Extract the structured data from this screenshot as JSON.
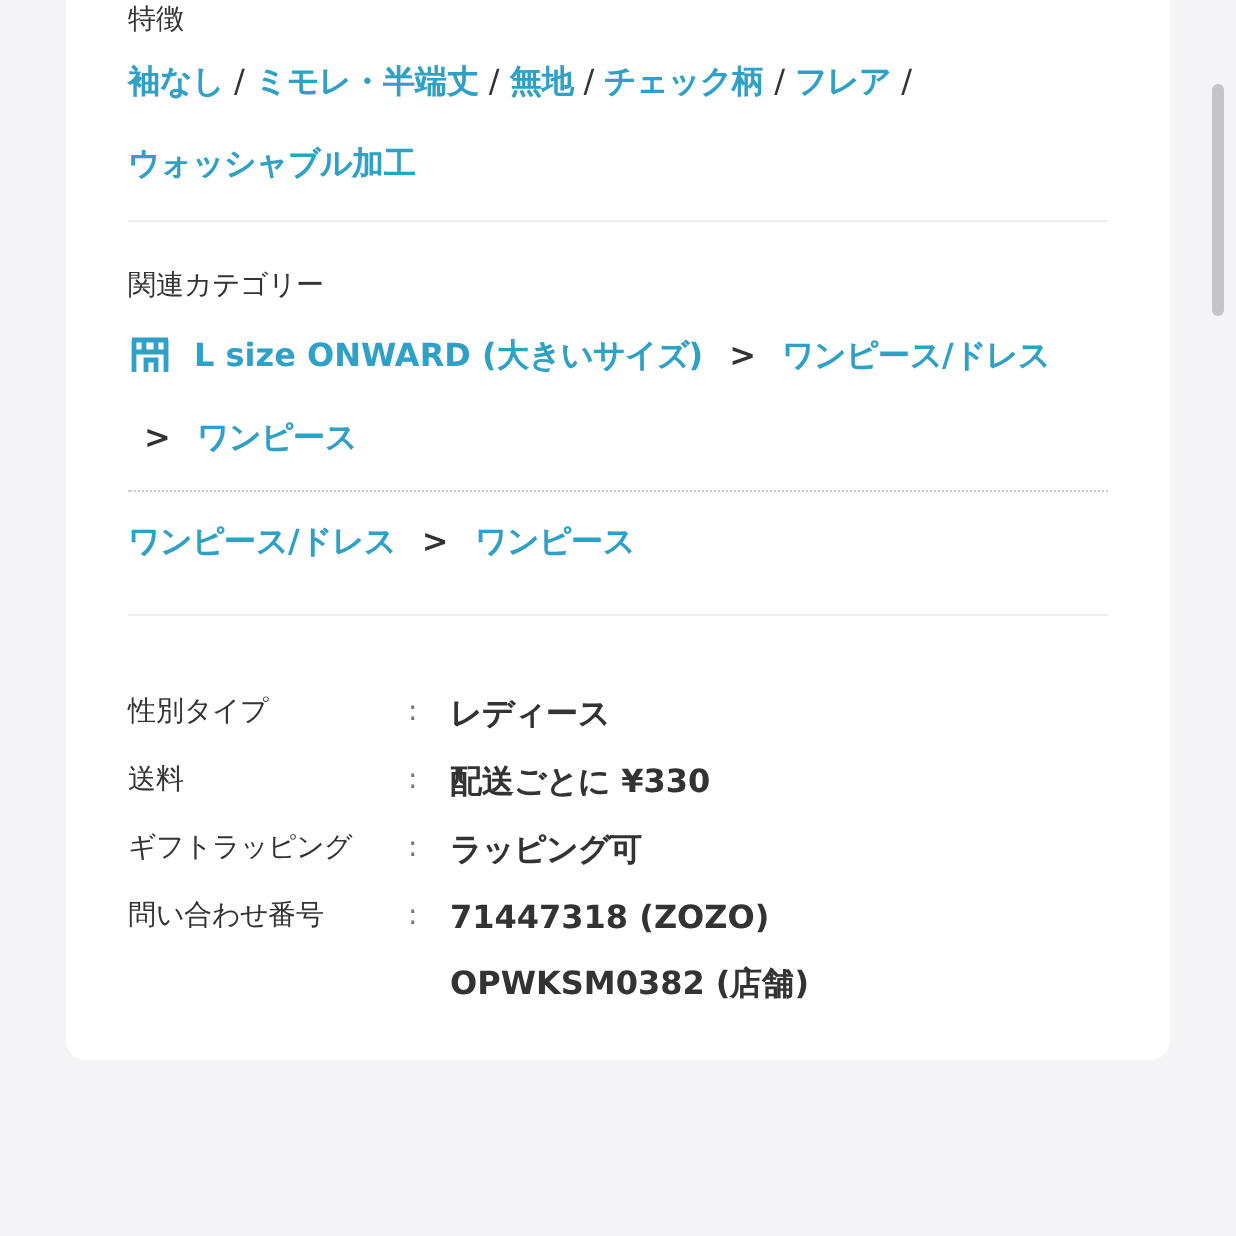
{
  "features": {
    "title": "特徴",
    "items": [
      {
        "label": "袖なし"
      },
      {
        "sep": "/",
        "label": "ミモレ・半端丈"
      },
      {
        "sep": "/",
        "label": "無地"
      },
      {
        "sep": "/",
        "label": "チェック柄"
      },
      {
        "sep": "/",
        "label": "フレア"
      },
      {
        "sep": "/",
        "label": "ウォッシャブル加工"
      }
    ]
  },
  "categories": {
    "title": "関連カテゴリー",
    "paths": [
      {
        "shop": true,
        "items": [
          {
            "label": "L size ONWARD (大きいサイズ)"
          },
          {
            "sep": ">",
            "label": "ワンピース/ドレス"
          },
          {
            "sep": ">",
            "label": "ワンピース"
          }
        ]
      },
      {
        "shop": false,
        "items": [
          {
            "label": "ワンピース/ドレス"
          },
          {
            "sep": ">",
            "label": "ワンピース"
          }
        ]
      }
    ]
  },
  "specs": [
    {
      "label": "性別タイプ",
      "colon": ":",
      "values": [
        "レディース"
      ]
    },
    {
      "label": "送料",
      "colon": ":",
      "values": [
        "配送ごとに ¥330"
      ]
    },
    {
      "label": "ギフトラッピング",
      "colon": ":",
      "values": [
        "ラッピング可"
      ]
    },
    {
      "label": "問い合わせ番号",
      "colon": ":",
      "values": [
        "71447318 (ZOZO)",
        "OPWKSM0382 (店舗)"
      ]
    }
  ]
}
